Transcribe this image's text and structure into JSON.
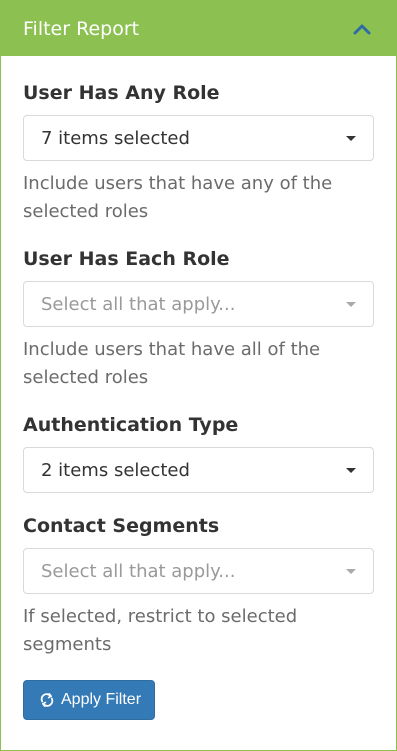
{
  "panel": {
    "title": "Filter Report",
    "header_color": "#8cc152",
    "collapse_icon": "chevron-up-icon"
  },
  "filters": [
    {
      "label": "User Has Any Role",
      "value": "7 items selected",
      "help": "Include users that have any of the selected roles"
    },
    {
      "label": "User Has Each Role",
      "placeholder": "Select all that apply...",
      "help": "Include users that have all of the selected roles"
    },
    {
      "label": "Authentication Type",
      "value": "2 items selected"
    },
    {
      "label": "Contact Segments",
      "placeholder": "Select all that apply...",
      "help": "If selected, restrict to selected segments"
    }
  ],
  "apply_button": {
    "label": "Apply Filter",
    "icon": "refresh-icon",
    "color": "#337ab7"
  }
}
